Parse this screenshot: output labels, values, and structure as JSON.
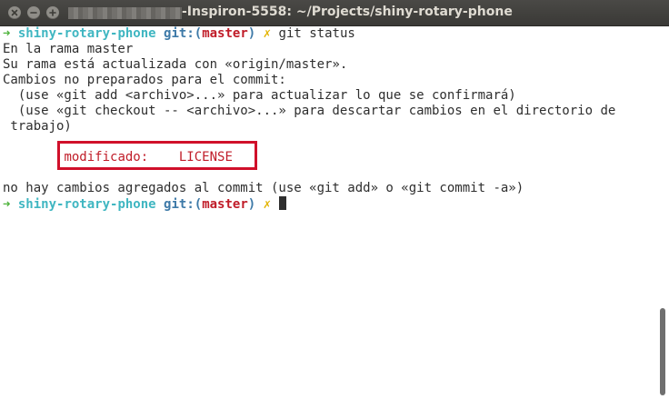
{
  "window": {
    "title": "-Inspiron-5558: ~/Projects/shiny-rotary-phone"
  },
  "prompt": {
    "arrow": "➜",
    "repo": "shiny-rotary-phone",
    "git_label": "git:(",
    "branch": "master",
    "close_paren": ")",
    "dirty_mark": "✗"
  },
  "command": "git status",
  "output": {
    "line1": "En la rama master",
    "line2": "Su rama está actualizada con «origin/master».",
    "line3": "Cambios no preparados para el commit:",
    "line4": "  (use «git add <archivo>...» para actualizar lo que se confirmará)",
    "line5": "  (use «git checkout -- <archivo>...» para descartar cambios en el directorio de",
    "line6": " trabajo)",
    "modified_label": "modificado:",
    "modified_file": "LICENSE",
    "line8": "no hay cambios agregados al commit (use «git add» o «git commit -a»)"
  },
  "icons": {
    "close": "close-icon",
    "minimize": "minimize-icon",
    "maximize": "maximize-icon"
  }
}
